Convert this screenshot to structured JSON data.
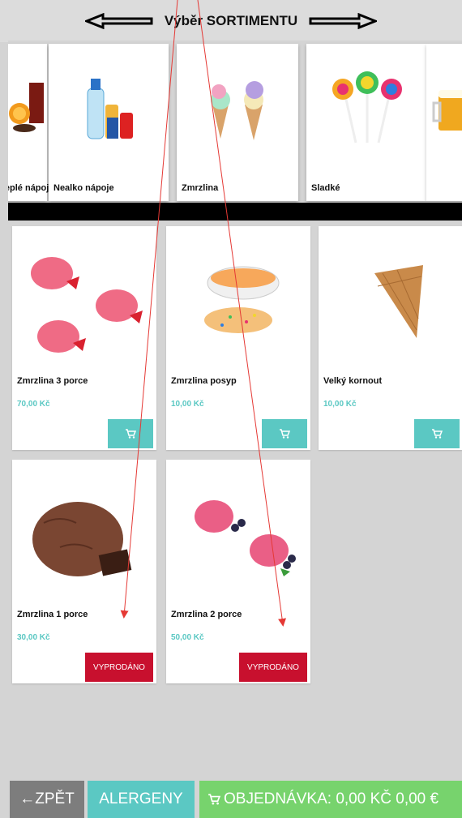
{
  "header": {
    "title": "Výběr SORTIMENTU"
  },
  "categories": [
    {
      "label": "Teplé nápoje",
      "icon": "hot-drink-image"
    },
    {
      "label": "Nealko nápoje",
      "icon": "soft-drinks-image"
    },
    {
      "label": "Zmrzlina",
      "icon": "ice-cream-cones-image"
    },
    {
      "label": "Sladké",
      "icon": "lollipops-image"
    },
    {
      "label": "",
      "icon": "beer-image"
    }
  ],
  "products": [
    {
      "name": "Zmrzlina 3 porce",
      "price": "70,00 Kč",
      "status": "cart"
    },
    {
      "name": "Zmrzlina posyp",
      "price": "10,00 Kč",
      "status": "cart"
    },
    {
      "name": "Velký kornout",
      "price": "10,00 Kč",
      "status": "cart"
    },
    {
      "name": "Zmrzlina 1 porce",
      "price": "30,00 Kč",
      "status": "sold_out",
      "sold_label": "VYPRODÁNO"
    },
    {
      "name": "Zmrzlina 2 porce",
      "price": "50,00 Kč",
      "status": "sold_out",
      "sold_label": "VYPRODÁNO"
    }
  ],
  "footer": {
    "back_label": "←ZPĚT",
    "allergens_label": "ALERGENY",
    "order_label": "OBJEDNÁVKA: 0,00 KČ  0,00 €"
  },
  "colors": {
    "accent": "#5bc8c3",
    "sold_out": "#c8102e",
    "order": "#77d36d",
    "back": "#7d7d7d",
    "annotation_arrow": "#e53935"
  }
}
